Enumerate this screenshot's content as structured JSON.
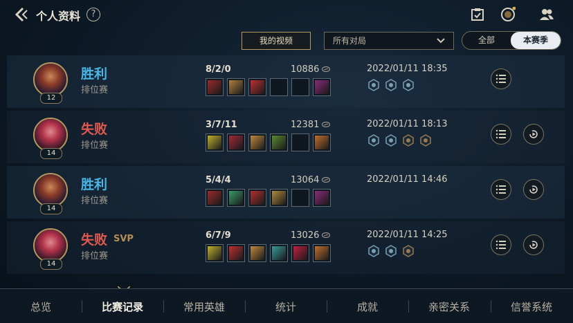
{
  "header": {
    "title": "个人资料",
    "help": "?",
    "icons": [
      "back-icon",
      "help-icon",
      "task-check-icon",
      "medal-icon",
      "friends-icon"
    ]
  },
  "filters": {
    "video_label": "我的视频",
    "match_select": "所有对局",
    "segment_all": "全部",
    "segment_season": "本赛季"
  },
  "matches": [
    {
      "result": "胜利",
      "svp": "",
      "mode": "排位赛",
      "level": "12",
      "kda": "8/2/0",
      "score": "10886",
      "datetime": "2022/01/11 18:35",
      "replay": false
    },
    {
      "result": "失败",
      "svp": "",
      "mode": "排位赛",
      "level": "14",
      "kda": "3/7/11",
      "score": "12381",
      "datetime": "2022/01/11 18:13",
      "replay": true
    },
    {
      "result": "胜利",
      "svp": "",
      "mode": "排位赛",
      "level": "14",
      "kda": "5/4/4",
      "score": "13064",
      "datetime": "2022/01/11 14:46",
      "replay": true
    },
    {
      "result": "失败",
      "svp": "SVP",
      "mode": "排位赛",
      "level": "14",
      "kda": "6/7/9",
      "score": "13026",
      "datetime": "2022/01/11 14:25",
      "replay": true
    }
  ],
  "nav": {
    "items": [
      "总览",
      "比赛记录",
      "常用英雄",
      "统计",
      "成就",
      "亲密关系",
      "信誉系统"
    ],
    "active_index": 1
  },
  "colors": {
    "win": "#4bb6e6",
    "lose": "#e05a52",
    "accent": "#b79a5e"
  }
}
